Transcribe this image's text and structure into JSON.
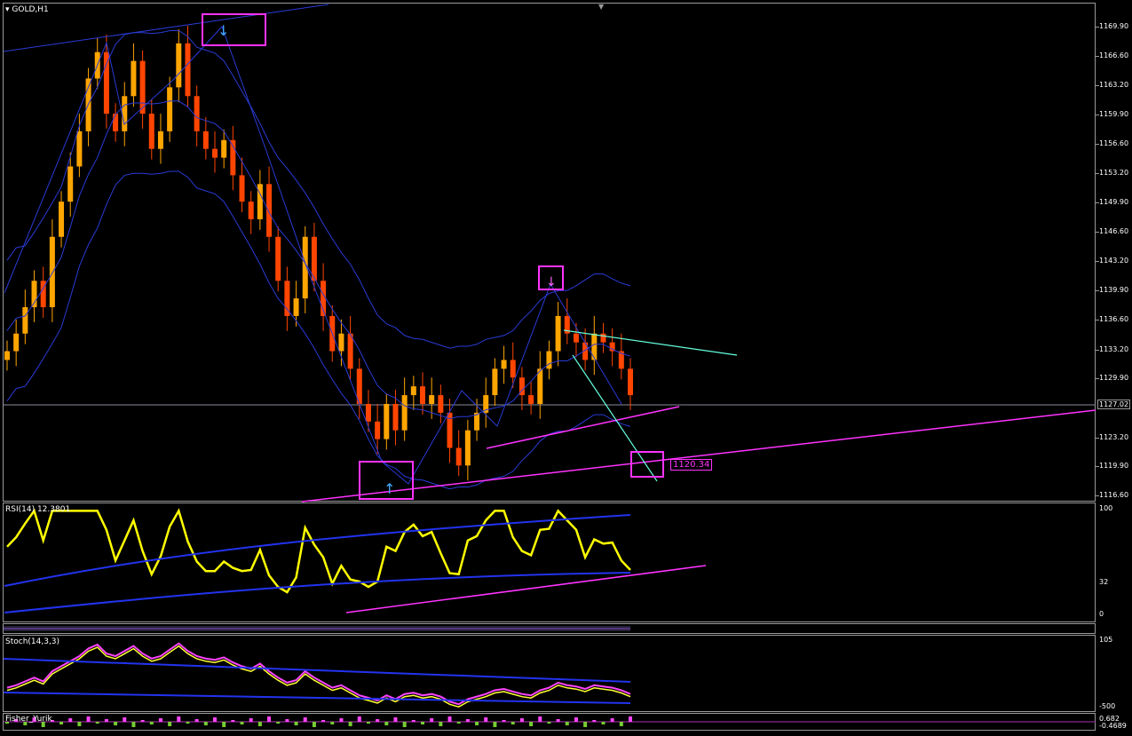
{
  "chart": {
    "symbol_label": "GOLD,H1",
    "current_price": "1127.02",
    "target_label": "1120.34",
    "price_ticks": [
      "1169.90",
      "1166.60",
      "1163.20",
      "1159.90",
      "1156.60",
      "1153.20",
      "1149.90",
      "1146.60",
      "1143.20",
      "1139.90",
      "1136.60",
      "1133.20",
      "1129.90",
      "1127.02",
      "1123.20",
      "1119.90",
      "1116.60"
    ]
  },
  "rsi": {
    "label": "RSI(14) 12.3801",
    "ticks": [
      "100",
      "32",
      "0"
    ]
  },
  "stoch": {
    "label": "Stoch(14,3,3)",
    "ticks": [
      "105",
      "-500"
    ]
  },
  "bottom": {
    "label": "Fisher_Yurik",
    "ticks": [
      "0.682",
      "-0.4689"
    ]
  },
  "colors": {
    "bull_candle": "#ffa500",
    "bear_candle": "#ff4500",
    "bands": "#2a3bd6",
    "trendline": "#ff33ff",
    "channel": "#66ffdd",
    "rsi_line": "#ffff00",
    "accent_box": "#ff33ff"
  },
  "chart_data": {
    "type": "candlestick",
    "ylim": [
      1116.6,
      1171.5
    ],
    "close_series_approx": [
      1133,
      1135,
      1138,
      1141,
      1138,
      1146,
      1150,
      1154,
      1158,
      1164,
      1167,
      1160,
      1158,
      1162,
      1166,
      1160,
      1156,
      1158,
      1163,
      1168,
      1162,
      1158,
      1156,
      1155,
      1157,
      1153,
      1150,
      1148,
      1152,
      1146,
      1141,
      1137,
      1139,
      1146,
      1141,
      1137,
      1133,
      1135,
      1131,
      1127,
      1125,
      1123,
      1127,
      1124,
      1128,
      1129,
      1127,
      1128,
      1126,
      1122,
      1120,
      1124,
      1126,
      1128,
      1131,
      1132,
      1130,
      1128,
      1127,
      1131,
      1133,
      1137,
      1135,
      1134,
      1132,
      1135,
      1134,
      1133,
      1131,
      1128
    ]
  }
}
